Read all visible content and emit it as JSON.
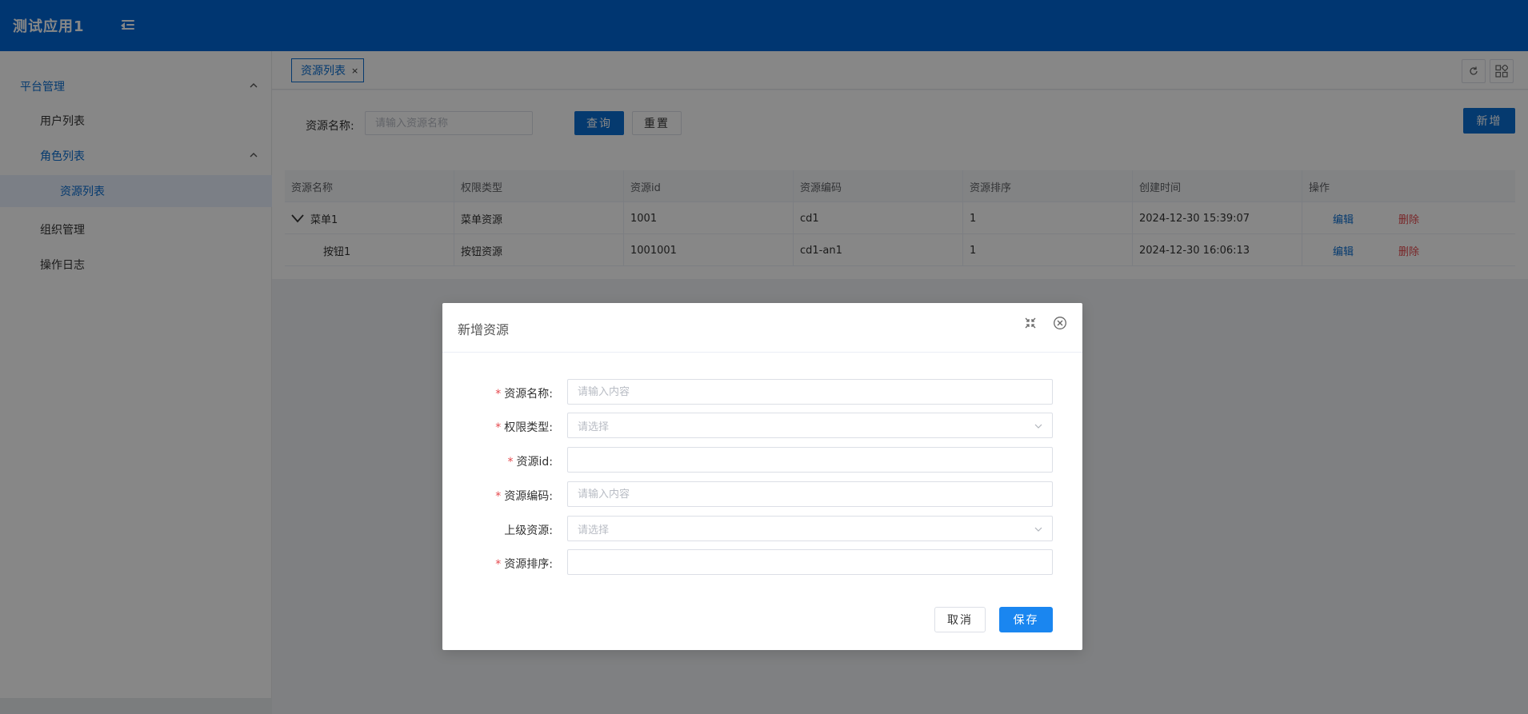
{
  "app": {
    "title": "测试应用1"
  },
  "sidebar": {
    "items": [
      {
        "label": "平台管理"
      },
      {
        "label": "用户列表"
      },
      {
        "label": "角色列表"
      },
      {
        "label": "资源列表"
      },
      {
        "label": "组织管理"
      },
      {
        "label": "操作日志"
      }
    ]
  },
  "tabs": [
    {
      "label": "资源列表",
      "close": "×"
    }
  ],
  "search": {
    "label": "资源名称:",
    "placeholder": "请输入资源名称",
    "query_button": "查询",
    "reset_button": "重置",
    "add_button": "新增"
  },
  "table": {
    "columns": [
      "资源名称",
      "权限类型",
      "资源id",
      "资源编码",
      "资源排序",
      "创建时间",
      "操作"
    ],
    "rows": [
      {
        "name": "菜单1",
        "type": "菜单资源",
        "id": "1001",
        "code": "cd1",
        "order": "1",
        "created": "2024-12-30 15:39:07",
        "edit": "编辑",
        "delete": "删除"
      },
      {
        "name": "按钮1",
        "type": "按钮资源",
        "id": "1001001",
        "code": "cd1-an1",
        "order": "1",
        "created": "2024-12-30 16:06:13",
        "edit": "编辑",
        "delete": "删除"
      }
    ]
  },
  "dialog": {
    "title": "新增资源",
    "fields": [
      {
        "label": "资源名称:",
        "placeholder": "请输入内容",
        "value": ""
      },
      {
        "label": "权限类型:",
        "placeholder": "请选择"
      },
      {
        "label": "资源id:",
        "placeholder": "",
        "value": ""
      },
      {
        "label": "资源编码:",
        "placeholder": "请输入内容",
        "value": ""
      },
      {
        "label": "上级资源:",
        "placeholder": "请选择"
      },
      {
        "label": "资源排序:",
        "placeholder": "",
        "value": ""
      }
    ],
    "required_mark": "*",
    "cancel_button": "取消",
    "save_button": "保存"
  },
  "colors": {
    "primary": "#0a6ed1",
    "header": "#0067d6",
    "danger": "#e5484d"
  }
}
